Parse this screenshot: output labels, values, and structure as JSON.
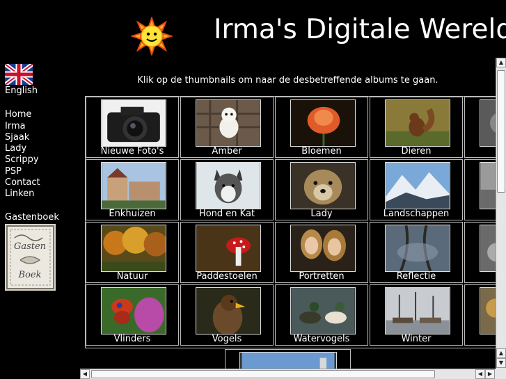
{
  "header": {
    "title": "Irma's Digitale Wereld",
    "logo_icon": "sun-icon"
  },
  "sidebar": {
    "language": "English",
    "nav": [
      "Home",
      "Irma",
      "Sjaak",
      "Lady",
      "Scrippy",
      "PSP",
      "Contact",
      "Linken"
    ],
    "guestbook_label": "Gastenboek",
    "guestbook_image_text": [
      "Gasten",
      "Boek"
    ]
  },
  "main": {
    "intro": "Klik op de thumbnails om naar de desbetreffende albums te gaan.",
    "albums": [
      "Nieuwe Foto's",
      "Amber",
      "Bloemen",
      "Dieren",
      "Di",
      "Enkhuizen",
      "Hond en Kat",
      "Lady",
      "Landschappen",
      "",
      "Natuur",
      "Paddestoelen",
      "Portretten",
      "Reflectie",
      "S",
      "Vlinders",
      "Vogels",
      "Watervogels",
      "Winter",
      "V"
    ]
  },
  "colors": {
    "background": "#000000",
    "text": "#ffffff",
    "border": "#bbbbbb"
  }
}
